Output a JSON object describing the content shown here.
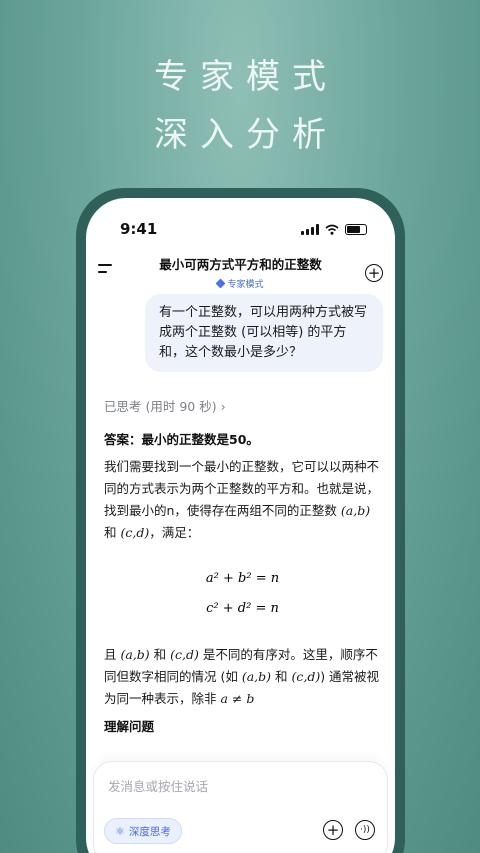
{
  "hero": {
    "line1": "专家模式",
    "line2": "深入分析"
  },
  "status": {
    "time": "9:41"
  },
  "header": {
    "title": "最小可两方式平方和的正整数",
    "mode_label": "专家模式"
  },
  "user_message": "有一个正整数，可以用两种方式被写成两个正整数 (可以相等) 的平方和，这个数最小是多少？",
  "answer": {
    "thought_label": "已思考 (用时 90 秒)",
    "chevron": "›",
    "headline": "答案：最小的正整数是50。",
    "para1_a": "我们需要找到一个最小的正整数，它可以以两种不同的方式表示为两个正整数的平方和。也就是说，找到最小的n，使得存在两组不同的正整数 ",
    "pair1": "(a,b)",
    "and1": " 和 ",
    "pair2": "(c,d)",
    "para1_b": "，满足：",
    "eq1": "a² + b² = n",
    "eq2": "c² + d² = n",
    "para2_a": "且 ",
    "para2_pair1": "(a,b)",
    "para2_and": " 和 ",
    "para2_pair2": "(c,d)",
    "para2_b": " 是不同的有序对。这里，顺序不同但数字相同的情况 (如 ",
    "para2_pair3": "(a,b)",
    "para2_c": " 和 ",
    "para2_pair4": "(c,d)",
    "para2_d": ") 通常被视为同一种表示，除非 ",
    "para2_ineq": "a ≠ b",
    "subheading": "理解问题"
  },
  "composer": {
    "placeholder": "发消息或按住说话",
    "deep_think_label": "深度思考",
    "plus_symbol": "+",
    "voice_symbol": "·))"
  },
  "colors": {
    "accent": "#4a6bd6",
    "bubble": "#eef2fb",
    "phone_frame": "#2f615a"
  }
}
